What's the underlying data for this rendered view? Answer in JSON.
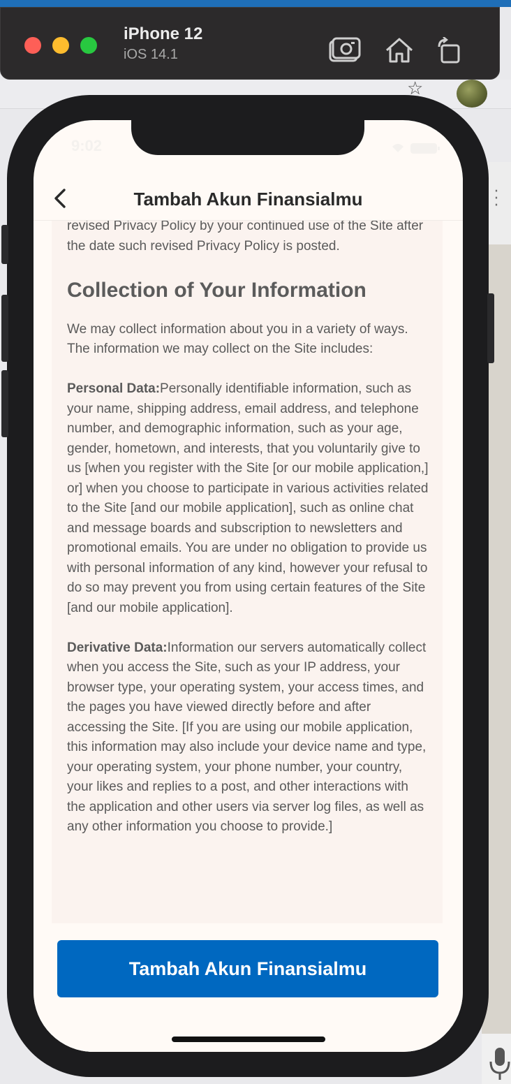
{
  "simulator": {
    "device_name": "iPhone 12",
    "os_version": "iOS 14.1"
  },
  "status_bar": {
    "time": "9:02"
  },
  "nav": {
    "title": "Tambah Akun Finansialmu"
  },
  "content": {
    "intro_tail": "revised Privacy Policy by your continued use of the Site after the date such revised Privacy Policy is posted.",
    "section_heading": "Collection of Your Information",
    "section_intro": "We may collect information about you in a variety of ways. The information we may collect on the Site includes:",
    "personal_label": "Personal Data:",
    "personal_text": "Personally identifiable information, such as your name, shipping address, email address, and telephone number, and demographic information, such as your age, gender, hometown, and interests, that you voluntarily give to us [when you register with the Site [or our mobile application,] or] when you choose to participate in various activities related to the Site [and our mobile application], such as online chat and message boards and subscription to newsletters and promotional emails. You are under no obligation to provide us with personal information of any kind, however your refusal to do so may prevent you from using certain features of the Site [and our mobile application].",
    "derivative_label": "Derivative Data:",
    "derivative_text": "Information our servers automatically collect when you access the Site, such as your IP address, your browser type, your operating system, your access times, and the pages you have viewed directly before and after accessing the Site. [If you are using our mobile application, this information may also include your device name and type, your operating system, your phone number, your country, your likes and replies to a post, and other interactions with the application and other users via server log files, as well as any other information you choose to provide.]"
  },
  "cta": {
    "label": "Tambah Akun Finansialmu"
  },
  "colors": {
    "primary_button": "#0068c0",
    "screen_background": "#fffaf6",
    "content_background": "#fbf3ef"
  },
  "icons": {
    "back": "chevron-left-icon",
    "screenshot": "camera-icon",
    "home": "home-icon",
    "rotate": "rotate-icon"
  }
}
